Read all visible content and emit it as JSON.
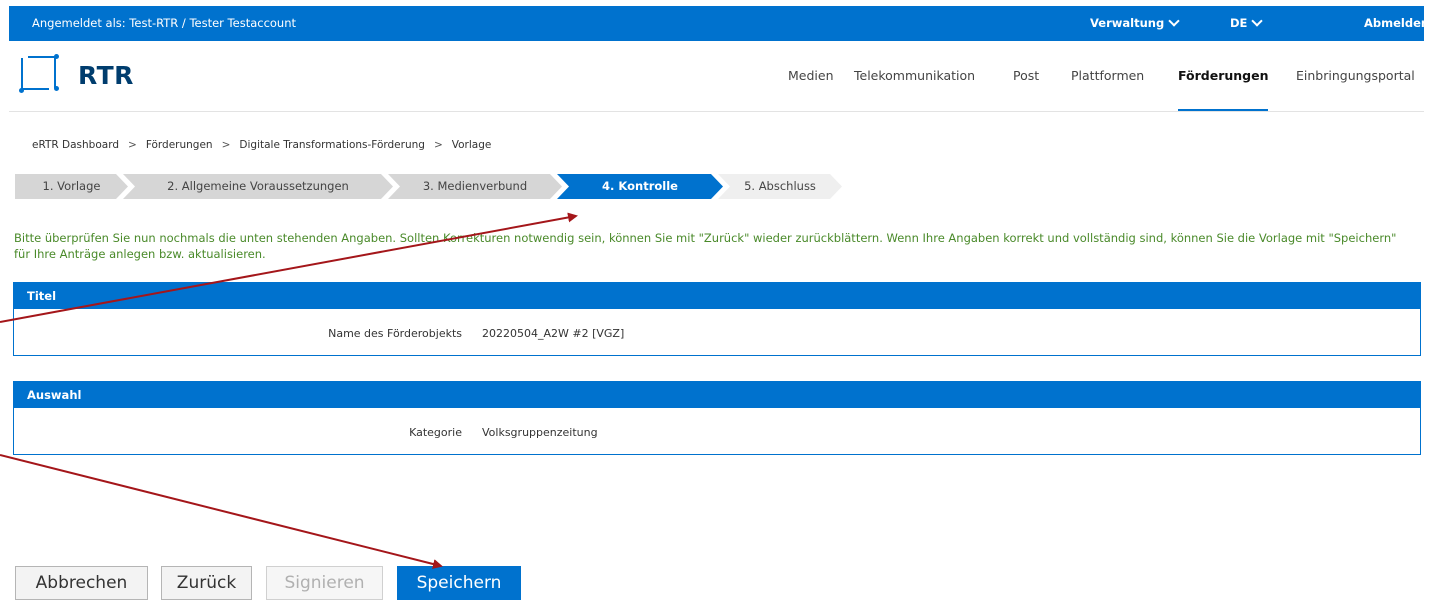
{
  "topbar": {
    "user": "Angemeldet als: Test-RTR / Tester Testaccount",
    "admin": "Verwaltung",
    "language": "DE",
    "logout": "Abmelden"
  },
  "logo": {
    "text": "RTR"
  },
  "nav": [
    "Medien",
    "Telekommunikation",
    "Post",
    "Plattformen",
    "Förderungen",
    "Einbringungsportal"
  ],
  "breadcrumb": [
    "eRTR Dashboard",
    "Förderungen",
    "Digitale Transformations-Förderung",
    "Vorlage"
  ],
  "breadcrumb_sep": ">",
  "steps": [
    "1. Vorlage",
    "2. Allgemeine Voraussetzungen",
    "3. Medienverbund",
    "4. Kontrolle",
    "5. Abschluss"
  ],
  "info": "Bitte überprüfen Sie nun nochmals die unten stehenden Angaben. Sollten Korrekturen notwendig sein, können Sie mit \"Zurück\" wieder zurückblättern. Wenn Ihre Angaben korrekt und vollständig sind, können Sie die Vorlage mit \"Speichern\" für Ihre Anträge anlegen bzw. aktualisieren.",
  "panels": {
    "titel": {
      "header": "Titel",
      "label": "Name des Förderobjekts",
      "value": "20220504_A2W #2 [VGZ]"
    },
    "auswahl": {
      "header": "Auswahl",
      "label": "Kategorie",
      "value": "Volksgruppenzeitung"
    }
  },
  "buttons": {
    "cancel": "Abbrechen",
    "back": "Zurück",
    "sign": "Signieren",
    "save": "Speichern"
  },
  "colors": {
    "primary": "#0072ce",
    "info_text": "#4a8a2a",
    "annotation": "#a4161a"
  }
}
